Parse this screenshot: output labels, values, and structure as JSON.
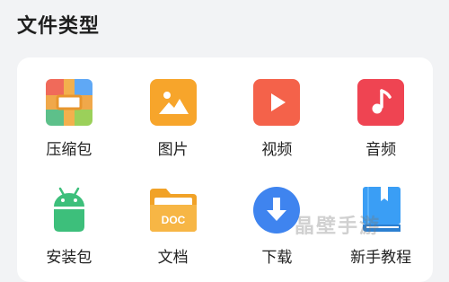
{
  "title": "文件类型",
  "categories": [
    {
      "label": "压缩包",
      "icon": "archive-icon",
      "name": "category-archive"
    },
    {
      "label": "图片",
      "icon": "image-icon",
      "name": "category-image"
    },
    {
      "label": "视频",
      "icon": "video-icon",
      "name": "category-video"
    },
    {
      "label": "音频",
      "icon": "audio-icon",
      "name": "category-audio"
    },
    {
      "label": "安装包",
      "icon": "android-icon",
      "name": "category-install-package"
    },
    {
      "label": "文档",
      "icon": "document-folder-icon",
      "name": "category-document"
    },
    {
      "label": "下载",
      "icon": "download-icon",
      "name": "category-download"
    },
    {
      "label": "新手教程",
      "icon": "book-icon",
      "name": "category-tutorial"
    }
  ],
  "doc_badge": "DOC",
  "watermark": "晶壁手游"
}
